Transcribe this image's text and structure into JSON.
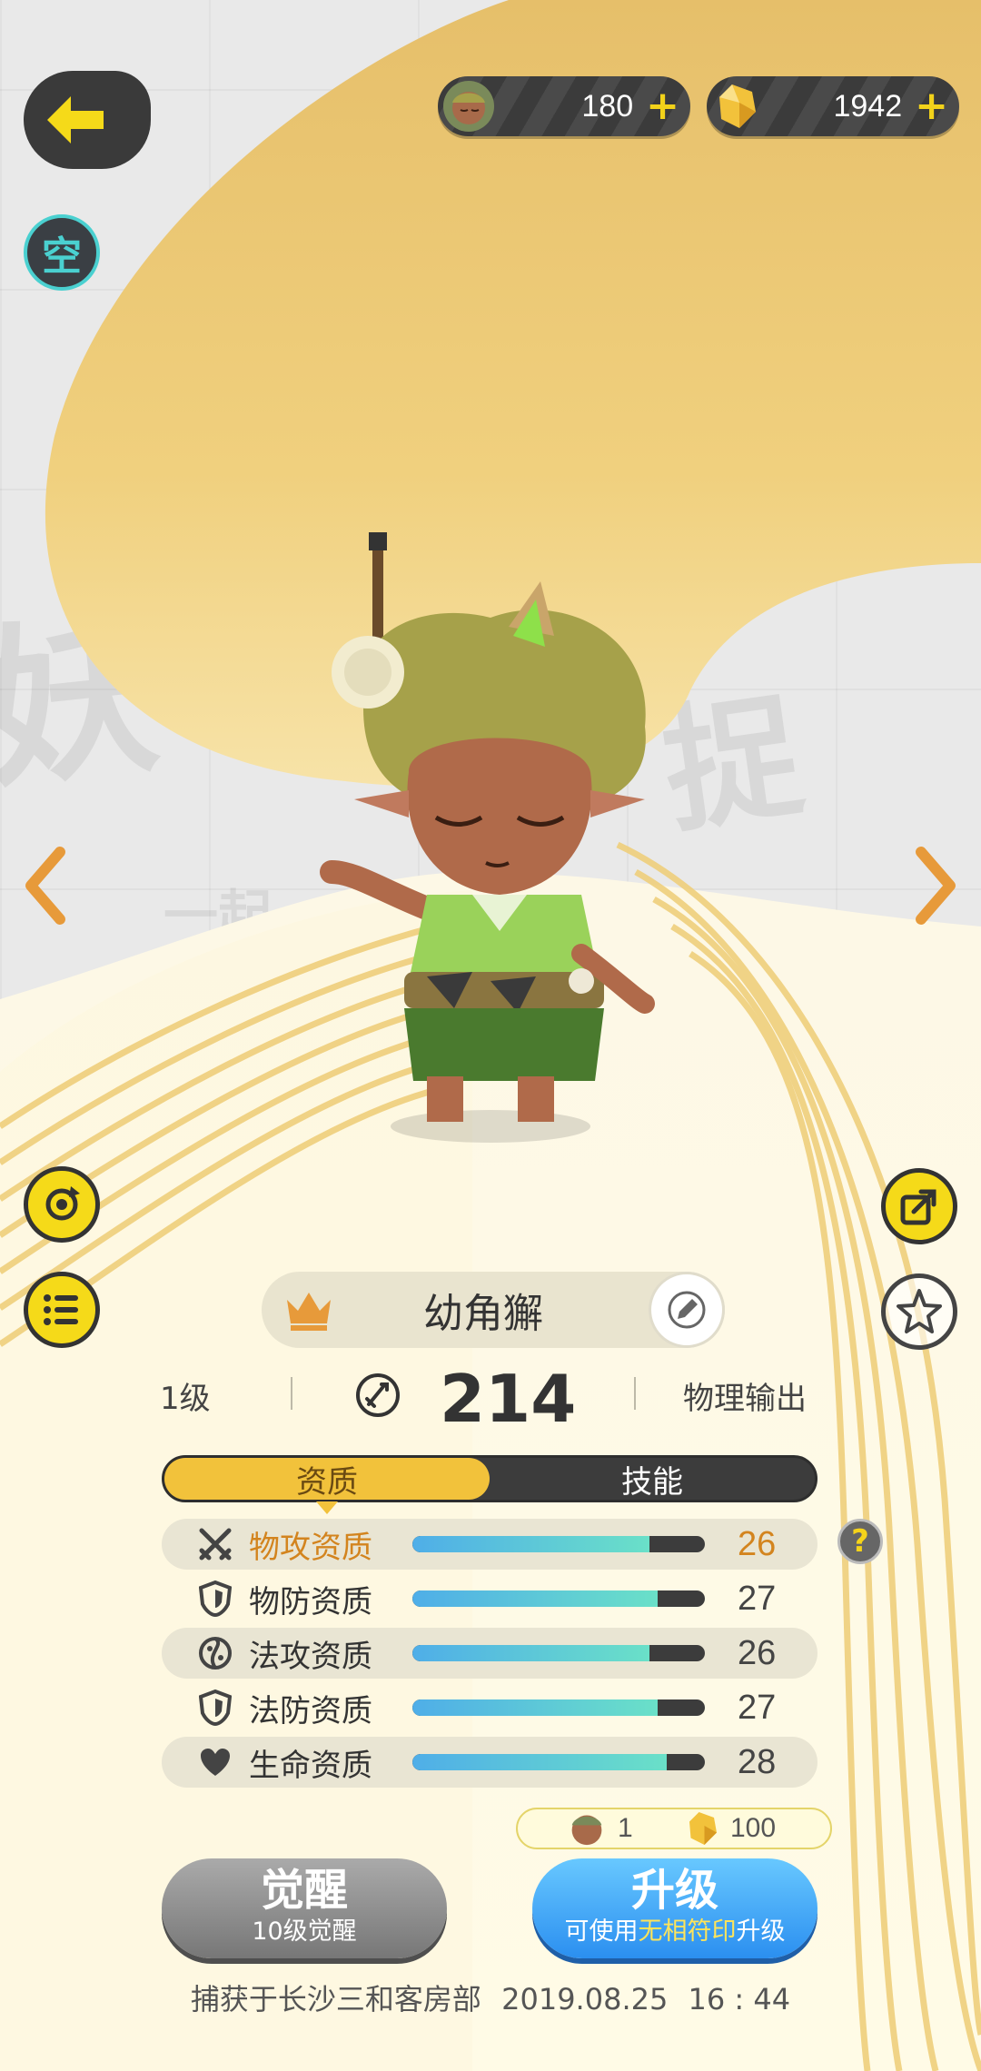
{
  "currency": {
    "coins": {
      "icon": "monster-coin-icon",
      "value": "180"
    },
    "gems": {
      "icon": "crystal-icon",
      "value": "1942"
    }
  },
  "badge": {
    "label": "空"
  },
  "pet": {
    "name": "幼角獬",
    "level": "1级",
    "power": "214",
    "role": "物理输出"
  },
  "tabs": [
    {
      "label": "资质",
      "active": true
    },
    {
      "label": "技能",
      "active": false
    }
  ],
  "attributes": [
    {
      "icon": "crossed-swords-icon",
      "label": "物攻资质",
      "value": "26",
      "fraction": 0.81
    },
    {
      "icon": "shield-icon",
      "label": "物防资质",
      "value": "27",
      "fraction": 0.84
    },
    {
      "icon": "magic-orb-icon",
      "label": "法攻资质",
      "value": "26",
      "fraction": 0.81
    },
    {
      "icon": "shield-icon",
      "label": "法防资质",
      "value": "27",
      "fraction": 0.84
    },
    {
      "icon": "heart-icon",
      "label": "生命资质",
      "value": "28",
      "fraction": 0.87
    }
  ],
  "cost": {
    "coin_amount": "1",
    "gem_amount": "100"
  },
  "buttons": {
    "awaken": {
      "label": "觉醒",
      "sub": "10级觉醒"
    },
    "upgrade": {
      "label": "升级",
      "sub_prefix": "可使用",
      "sub_highlight": "无相符印",
      "sub_suffix": "升级"
    }
  },
  "capture": {
    "place": "捕获于长沙三和客房部",
    "date": "2019.08.25",
    "time": "16 : 44"
  },
  "colors": {
    "accent_yellow": "#f5da19",
    "tab_active": "#f2c23b",
    "highlight_orange": "#d3841e",
    "upgrade_blue": "#2b8ff0"
  }
}
